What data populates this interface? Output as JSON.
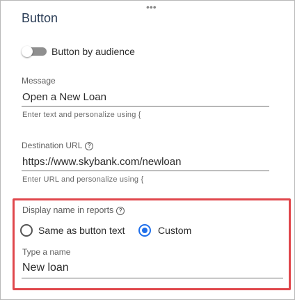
{
  "panel": {
    "drag_handle": "•••",
    "title": "Button"
  },
  "toggle": {
    "label": "Button by audience",
    "state": "off"
  },
  "message": {
    "label": "Message",
    "value": "Open a New Loan",
    "hint": "Enter text and personalize using {"
  },
  "destination_url": {
    "label": "Destination URL",
    "help_icon": "?",
    "value": "https://www.skybank.com/newloan",
    "hint": "Enter URL and personalize using {"
  },
  "display_name": {
    "label": "Display name in reports",
    "help_icon": "?",
    "options": [
      {
        "label": "Same as button text",
        "selected": false
      },
      {
        "label": "Custom",
        "selected": true
      }
    ],
    "name_field": {
      "label": "Type a name",
      "value": "New loan"
    }
  },
  "colors": {
    "highlight_border": "#e0474c",
    "radio_selected": "#1f6feb",
    "title_text": "#2c3e57"
  }
}
